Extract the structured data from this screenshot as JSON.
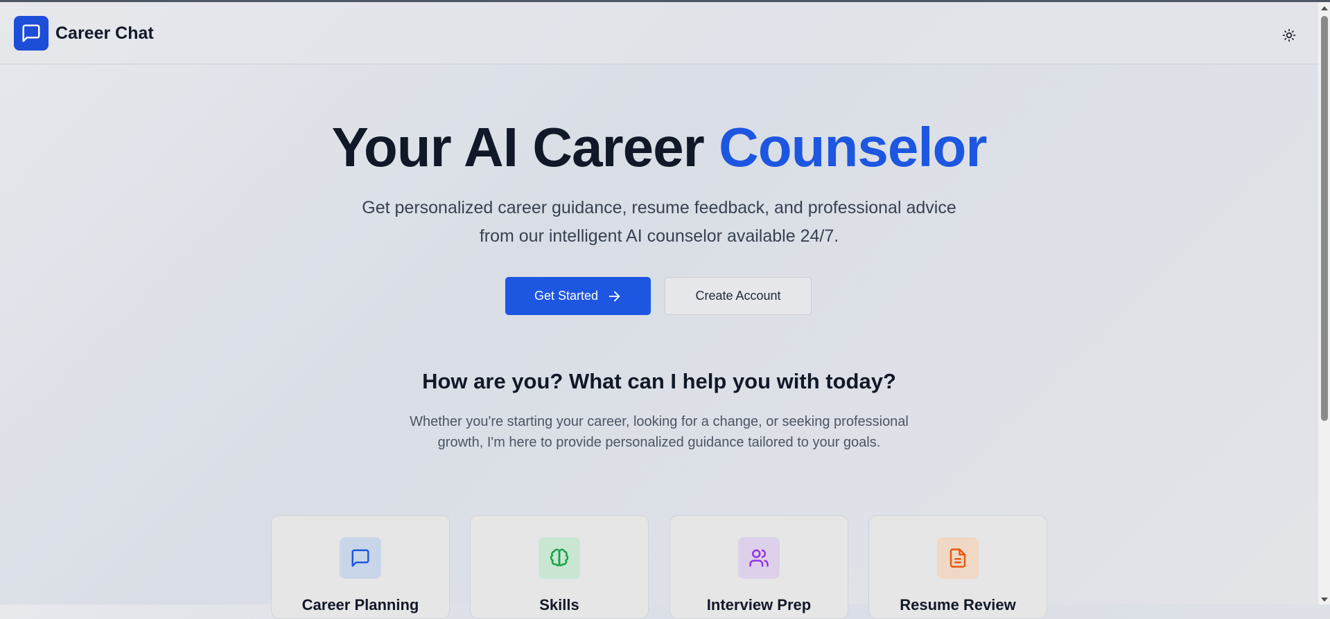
{
  "header": {
    "app_name": "Career Chat",
    "logo_icon": "chat-bubble-icon",
    "theme_toggle_icon": "sun-icon"
  },
  "hero": {
    "title_main": "Your AI Career ",
    "title_accent": "Counselor",
    "subtitle": "Get personalized career guidance, resume feedback, and professional advice from our intelligent AI counselor available 24/7.",
    "primary_button": "Get Started",
    "primary_button_icon": "arrow-right-icon",
    "secondary_button": "Create Account"
  },
  "help_section": {
    "title": "How are you? What can I help you with today?",
    "description": "Whether you're starting your career, looking for a change, or seeking professional growth, I'm here to provide personalized guidance tailored to your goals."
  },
  "features": [
    {
      "title": "Career Planning",
      "icon": "message-square-icon",
      "icon_color": "#1d56e0",
      "bg_color": "#c9d6ea"
    },
    {
      "title": "Skills",
      "icon": "brain-icon",
      "icon_color": "#16a34a",
      "bg_color": "#c9e6d2"
    },
    {
      "title": "Interview Prep",
      "icon": "users-icon",
      "icon_color": "#9333ea",
      "bg_color": "#ddd0ea"
    },
    {
      "title": "Resume Review",
      "icon": "file-text-icon",
      "icon_color": "#ea580c",
      "bg_color": "#efd8c6"
    }
  ],
  "colors": {
    "accent": "#1d56e0",
    "text_dark": "#111827",
    "text_muted": "#4b5563"
  }
}
